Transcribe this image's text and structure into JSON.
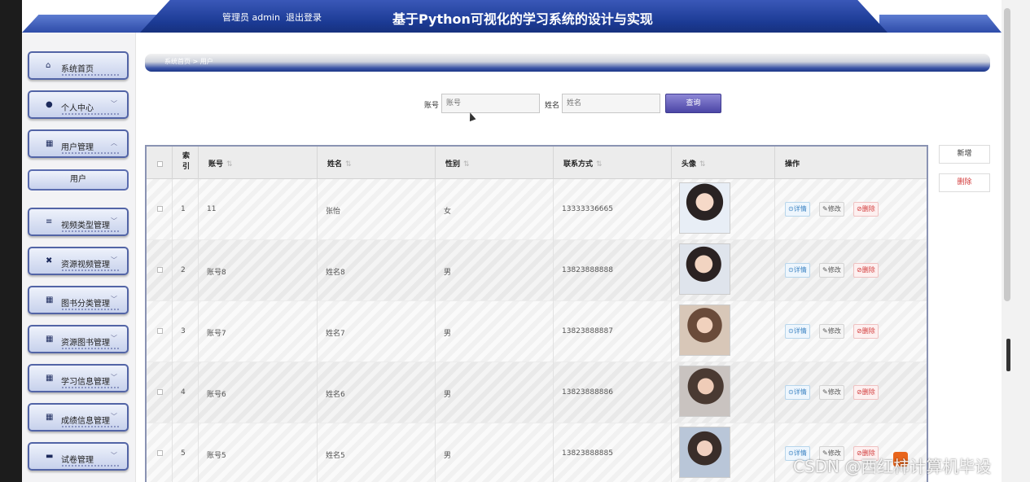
{
  "header": {
    "role": "管理员 admin",
    "logout": "退出登录",
    "title": "基于Python可视化的学习系统的设计与实现"
  },
  "sidebar": {
    "items": [
      {
        "label": "系统首页",
        "icon": "home-icon"
      },
      {
        "label": "个人中心",
        "icon": "user-icon"
      },
      {
        "label": "用户管理",
        "icon": "grid-icon"
      },
      {
        "label": "视频类型管理",
        "icon": "list-icon"
      },
      {
        "label": "资源视频管理",
        "icon": "video-icon"
      },
      {
        "label": "图书分类管理",
        "icon": "grid-icon"
      },
      {
        "label": "资源图书管理",
        "icon": "grid-icon"
      },
      {
        "label": "学习信息管理",
        "icon": "grid-icon"
      },
      {
        "label": "成绩信息管理",
        "icon": "grid-icon"
      },
      {
        "label": "试卷管理",
        "icon": "monitor-icon"
      }
    ],
    "submenu": "用户"
  },
  "breadcrumb": {
    "home": "系统首页",
    "sep": ">",
    "current": "用户"
  },
  "search": {
    "account_label": "账号",
    "account_placeholder": "账号",
    "name_label": "姓名",
    "name_placeholder": "姓名",
    "button": "查询"
  },
  "actions": {
    "add": "新增",
    "delete": "删除"
  },
  "table": {
    "headers": {
      "index": "索引",
      "account": "账号",
      "name": "姓名",
      "gender": "性别",
      "phone": "联系方式",
      "avatar": "头像",
      "ops": "操作"
    },
    "op_labels": {
      "view": "⊙详情",
      "edit": "✎修改",
      "delete": "⊘删除"
    },
    "rows": [
      {
        "index": "1",
        "account": "11",
        "name": "张怡",
        "gender": "女",
        "phone": "13333336665"
      },
      {
        "index": "2",
        "account": "账号8",
        "name": "姓名8",
        "gender": "男",
        "phone": "13823888888"
      },
      {
        "index": "3",
        "account": "账号7",
        "name": "姓名7",
        "gender": "男",
        "phone": "13823888887"
      },
      {
        "index": "4",
        "account": "账号6",
        "name": "姓名6",
        "gender": "男",
        "phone": "13823888886"
      },
      {
        "index": "5",
        "account": "账号5",
        "name": "姓名5",
        "gender": "男",
        "phone": "13823888885"
      }
    ]
  },
  "watermark": "CSDN @西红柿计算机毕设"
}
